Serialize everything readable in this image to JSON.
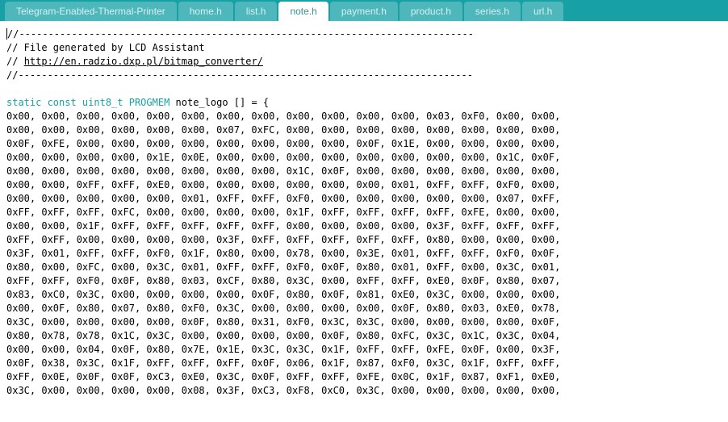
{
  "tabs": [
    {
      "label": "Telegram-Enabled-Thermal-Printer",
      "active": false
    },
    {
      "label": "home.h",
      "active": false
    },
    {
      "label": "list.h",
      "active": false
    },
    {
      "label": "note.h",
      "active": true
    },
    {
      "label": "payment.h",
      "active": false
    },
    {
      "label": "product.h",
      "active": false
    },
    {
      "label": "series.h",
      "active": false
    },
    {
      "label": "url.h",
      "active": false
    }
  ],
  "code": {
    "line1": "//------------------------------------------------------------------------------",
    "line2a": "// File generated by LCD Assistant",
    "line3a": "// ",
    "line3link": "http://en.radzio.dxp.pl/bitmap_converter/",
    "line4": "//------------------------------------------------------------------------------",
    "decl_kw": "static const uint8_t",
    "decl_pm": " PROGMEM",
    "decl_rest": " note_logo [] = {",
    "rows": [
      "0x00, 0x00, 0x00, 0x00, 0x00, 0x00, 0x00, 0x00, 0x00, 0x00, 0x00, 0x00, 0x03, 0xF0, 0x00, 0x00,",
      "0x00, 0x00, 0x00, 0x00, 0x00, 0x00, 0x07, 0xFC, 0x00, 0x00, 0x00, 0x00, 0x00, 0x00, 0x00, 0x00,",
      "0x0F, 0xFE, 0x00, 0x00, 0x00, 0x00, 0x00, 0x00, 0x00, 0x00, 0x0F, 0x1E, 0x00, 0x00, 0x00, 0x00,",
      "0x00, 0x00, 0x00, 0x00, 0x1E, 0x0E, 0x00, 0x00, 0x00, 0x00, 0x00, 0x00, 0x00, 0x00, 0x1C, 0x0F,",
      "0x00, 0x00, 0x00, 0x00, 0x00, 0x00, 0x00, 0x00, 0x1C, 0x0F, 0x00, 0x00, 0x00, 0x00, 0x00, 0x00,",
      "0x00, 0x00, 0xFF, 0xFF, 0xE0, 0x00, 0x00, 0x00, 0x00, 0x00, 0x00, 0x01, 0xFF, 0xFF, 0xF0, 0x00,",
      "0x00, 0x00, 0x00, 0x00, 0x00, 0x01, 0xFF, 0xFF, 0xF0, 0x00, 0x00, 0x00, 0x00, 0x00, 0x07, 0xFF,",
      "0xFF, 0xFF, 0xFF, 0xFC, 0x00, 0x00, 0x00, 0x00, 0x1F, 0xFF, 0xFF, 0xFF, 0xFF, 0xFE, 0x00, 0x00,",
      "0x00, 0x00, 0x1F, 0xFF, 0xFF, 0xFF, 0xFF, 0xFF, 0x00, 0x00, 0x00, 0x00, 0x3F, 0xFF, 0xFF, 0xFF,",
      "0xFF, 0xFF, 0x00, 0x00, 0x00, 0x00, 0x3F, 0xFF, 0xFF, 0xFF, 0xFF, 0xFF, 0x80, 0x00, 0x00, 0x00,",
      "0x3F, 0x01, 0xFF, 0xFF, 0xF0, 0x1F, 0x80, 0x00, 0x78, 0x00, 0x3E, 0x01, 0xFF, 0xFF, 0xF0, 0x0F,",
      "0x80, 0x00, 0xFC, 0x00, 0x3C, 0x01, 0xFF, 0xFF, 0xF0, 0x0F, 0x80, 0x01, 0xFF, 0x00, 0x3C, 0x01,",
      "0xFF, 0xFF, 0xF0, 0x0F, 0x80, 0x03, 0xCF, 0x80, 0x3C, 0x00, 0xFF, 0xFF, 0xE0, 0x0F, 0x80, 0x07,",
      "0x83, 0xC0, 0x3C, 0x00, 0x00, 0x00, 0x00, 0x0F, 0x80, 0x0F, 0x81, 0xE0, 0x3C, 0x00, 0x00, 0x00,",
      "0x00, 0x0F, 0x80, 0x07, 0x80, 0xF0, 0x3C, 0x00, 0x00, 0x00, 0x00, 0x0F, 0x80, 0x03, 0xE0, 0x78,",
      "0x3C, 0x00, 0x00, 0x00, 0x00, 0x0F, 0x80, 0x31, 0xF0, 0x3C, 0x3C, 0x00, 0x00, 0x00, 0x00, 0x0F,",
      "0x80, 0x78, 0x78, 0x1C, 0x3C, 0x00, 0x00, 0x00, 0x00, 0x0F, 0x80, 0xFC, 0x3C, 0x1C, 0x3C, 0x04,",
      "0x00, 0x00, 0x04, 0x0F, 0x80, 0x7E, 0x1E, 0x3C, 0x3C, 0x1F, 0xFF, 0xFF, 0xFE, 0x0F, 0x00, 0x3F,",
      "0x0F, 0x38, 0x3C, 0x1F, 0xFF, 0xFF, 0xFF, 0x0F, 0x06, 0x1F, 0x87, 0xF0, 0x3C, 0x1F, 0xFF, 0xFF,",
      "0xFF, 0x0E, 0x0F, 0x0F, 0xC3, 0xE0, 0x3C, 0x0F, 0xFF, 0xFF, 0xFE, 0x0C, 0x1F, 0x87, 0xF1, 0xE0,",
      "0x3C, 0x00, 0x00, 0x00, 0x00, 0x08, 0x3F, 0xC3, 0xF8, 0xC0, 0x3C, 0x00, 0x00, 0x00, 0x00, 0x00,"
    ]
  }
}
